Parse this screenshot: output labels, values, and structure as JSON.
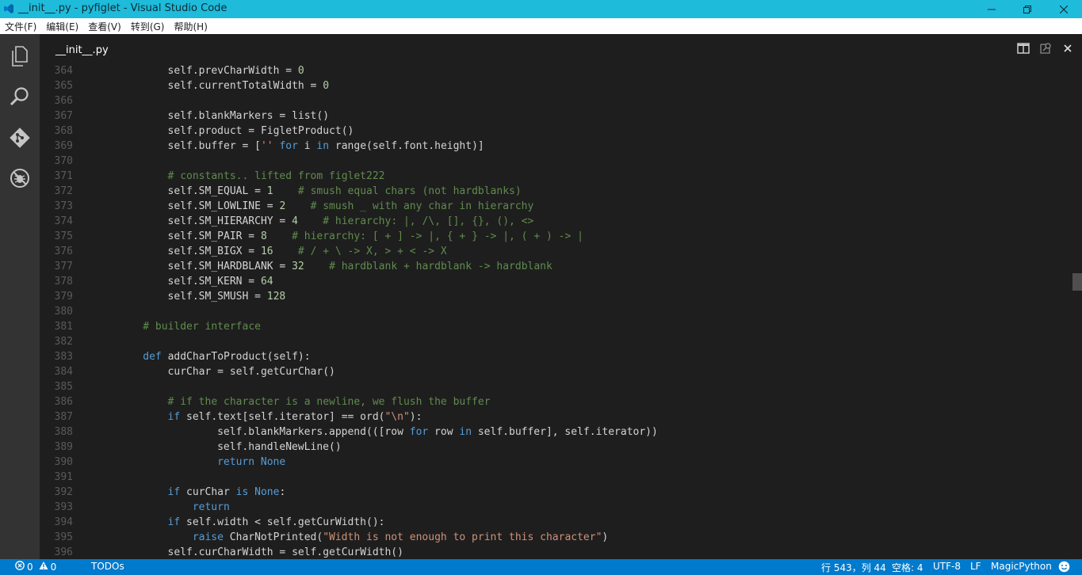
{
  "window": {
    "title": "__init__.py - pyfiglet - Visual Studio Code"
  },
  "menu": [
    {
      "label": "文件(F)"
    },
    {
      "label": "编辑(E)"
    },
    {
      "label": "查看(V)"
    },
    {
      "label": "转到(G)"
    },
    {
      "label": "帮助(H)"
    }
  ],
  "tab": {
    "label": "__init__.py"
  },
  "code_lines": [
    {
      "n": "364",
      "i": 8,
      "t": [
        [
          "self.prevCharWidth = ",
          ""
        ],
        [
          "0",
          "num"
        ]
      ]
    },
    {
      "n": "365",
      "i": 8,
      "t": [
        [
          "self.currentTotalWidth = ",
          ""
        ],
        [
          "0",
          "num"
        ]
      ]
    },
    {
      "n": "366",
      "i": 0,
      "t": []
    },
    {
      "n": "367",
      "i": 8,
      "t": [
        [
          "self.blankMarkers = list()",
          ""
        ]
      ]
    },
    {
      "n": "368",
      "i": 8,
      "t": [
        [
          "self.product = FigletProduct()",
          ""
        ]
      ]
    },
    {
      "n": "369",
      "i": 8,
      "t": [
        [
          "self.buffer = [",
          ""
        ],
        [
          "''",
          "str"
        ],
        [
          " ",
          ""
        ],
        [
          "for",
          "kw"
        ],
        [
          " i ",
          ""
        ],
        [
          "in",
          "kw"
        ],
        [
          " range(self.font.height)]",
          ""
        ]
      ]
    },
    {
      "n": "370",
      "i": 0,
      "t": []
    },
    {
      "n": "371",
      "i": 8,
      "t": [
        [
          "# constants.. lifted from figlet222",
          "cmt"
        ]
      ]
    },
    {
      "n": "372",
      "i": 8,
      "t": [
        [
          "self.SM_EQUAL = ",
          ""
        ],
        [
          "1",
          "num"
        ],
        [
          "    ",
          ""
        ],
        [
          "# smush equal chars (not hardblanks)",
          "cmt"
        ]
      ]
    },
    {
      "n": "373",
      "i": 8,
      "t": [
        [
          "self.SM_LOWLINE = ",
          ""
        ],
        [
          "2",
          "num"
        ],
        [
          "    ",
          ""
        ],
        [
          "# smush _ with any char in hierarchy",
          "cmt"
        ]
      ]
    },
    {
      "n": "374",
      "i": 8,
      "t": [
        [
          "self.SM_HIERARCHY = ",
          ""
        ],
        [
          "4",
          "num"
        ],
        [
          "    ",
          ""
        ],
        [
          "# hierarchy: |, /\\, [], {}, (), <>",
          "cmt"
        ]
      ]
    },
    {
      "n": "375",
      "i": 8,
      "t": [
        [
          "self.SM_PAIR = ",
          ""
        ],
        [
          "8",
          "num"
        ],
        [
          "    ",
          ""
        ],
        [
          "# hierarchy: [ + ] -> |, { + } -> |, ( + ) -> |",
          "cmt"
        ]
      ]
    },
    {
      "n": "376",
      "i": 8,
      "t": [
        [
          "self.SM_BIGX = ",
          ""
        ],
        [
          "16",
          "num"
        ],
        [
          "    ",
          ""
        ],
        [
          "# / + \\ -> X, > + < -> X",
          "cmt"
        ]
      ]
    },
    {
      "n": "377",
      "i": 8,
      "t": [
        [
          "self.SM_HARDBLANK = ",
          ""
        ],
        [
          "32",
          "num"
        ],
        [
          "    ",
          ""
        ],
        [
          "# hardblank + hardblank -> hardblank",
          "cmt"
        ]
      ]
    },
    {
      "n": "378",
      "i": 8,
      "t": [
        [
          "self.SM_KERN = ",
          ""
        ],
        [
          "64",
          "num"
        ]
      ]
    },
    {
      "n": "379",
      "i": 8,
      "t": [
        [
          "self.SM_SMUSH = ",
          ""
        ],
        [
          "128",
          "num"
        ]
      ]
    },
    {
      "n": "380",
      "i": 0,
      "t": []
    },
    {
      "n": "381",
      "i": 4,
      "t": [
        [
          "# builder interface",
          "cmt"
        ]
      ]
    },
    {
      "n": "382",
      "i": 0,
      "t": []
    },
    {
      "n": "383",
      "i": 4,
      "t": [
        [
          "def",
          "kw"
        ],
        [
          " addCharToProduct(self):",
          ""
        ]
      ]
    },
    {
      "n": "384",
      "i": 8,
      "t": [
        [
          "curChar = self.getCurChar()",
          ""
        ]
      ]
    },
    {
      "n": "385",
      "i": 0,
      "t": []
    },
    {
      "n": "386",
      "i": 8,
      "t": [
        [
          "# if the character is a newline, we flush the buffer",
          "cmt"
        ]
      ]
    },
    {
      "n": "387",
      "i": 8,
      "t": [
        [
          "if",
          "kw"
        ],
        [
          " self.text[self.iterator] == ord(",
          ""
        ],
        [
          "\"\\n\"",
          "str"
        ],
        [
          "):",
          ""
        ]
      ]
    },
    {
      "n": "388",
      "i": 16,
      "t": [
        [
          "self.blankMarkers.append(([row ",
          ""
        ],
        [
          "for",
          "kw"
        ],
        [
          " row ",
          ""
        ],
        [
          "in",
          "kw"
        ],
        [
          " self.buffer], self.iterator))",
          ""
        ]
      ]
    },
    {
      "n": "389",
      "i": 16,
      "t": [
        [
          "self.handleNewLine()",
          ""
        ]
      ]
    },
    {
      "n": "390",
      "i": 16,
      "t": [
        [
          "return",
          "kw"
        ],
        [
          " ",
          ""
        ],
        [
          "None",
          "kw"
        ]
      ]
    },
    {
      "n": "391",
      "i": 0,
      "t": []
    },
    {
      "n": "392",
      "i": 8,
      "t": [
        [
          "if",
          "kw"
        ],
        [
          " curChar ",
          ""
        ],
        [
          "is",
          "kw"
        ],
        [
          " ",
          ""
        ],
        [
          "None",
          "kw"
        ],
        [
          ":",
          ""
        ]
      ]
    },
    {
      "n": "393",
      "i": 12,
      "t": [
        [
          "return",
          "kw"
        ]
      ]
    },
    {
      "n": "394",
      "i": 8,
      "t": [
        [
          "if",
          "kw"
        ],
        [
          " self.width < self.getCurWidth():",
          ""
        ]
      ]
    },
    {
      "n": "395",
      "i": 12,
      "t": [
        [
          "raise",
          "kw"
        ],
        [
          " CharNotPrinted(",
          ""
        ],
        [
          "\"Width is not enough to print this character\"",
          "str"
        ],
        [
          ")",
          ""
        ]
      ]
    },
    {
      "n": "396",
      "i": 8,
      "t": [
        [
          "self.curCharWidth = self.getCurWidth()",
          ""
        ]
      ]
    }
  ],
  "status": {
    "errors": "0",
    "warnings": "0",
    "todos": "TODOs",
    "position": "行 543，列 44",
    "indent": "空格: 4",
    "encoding": "UTF-8",
    "eol": "LF",
    "language": "MagicPython"
  },
  "colors": {
    "titlebar": "#1ebbdb",
    "statusbar": "#007acc",
    "activitybar": "#333333",
    "editor_bg": "#1e1e1e"
  },
  "icons": {
    "activity": [
      "files-icon",
      "search-icon",
      "git-icon",
      "debug-icon"
    ],
    "editor_actions": [
      "split-editor-icon",
      "open-changes-icon",
      "close-icon"
    ],
    "status": [
      "error-icon",
      "warning-icon",
      "feedback-smiley-icon"
    ]
  }
}
